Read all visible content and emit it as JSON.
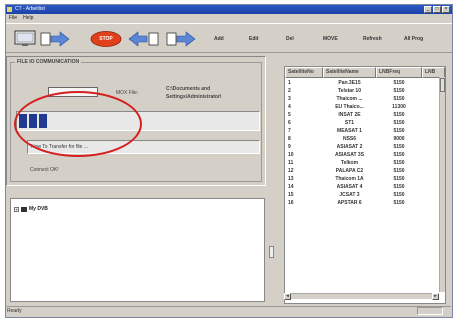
{
  "window": {
    "title": "CT - Arbeitlist",
    "minimize": "_",
    "restore": "□",
    "close": "×"
  },
  "menu": [
    "File",
    "Help"
  ],
  "toolbar": {
    "stop": "STOP",
    "add": "Add",
    "edit": "Edit",
    "del": "Del",
    "move": "MOVE",
    "refresh": "Refresh",
    "all_prog": "All Prog"
  },
  "transfer": {
    "group_title": "FILE IO COMMUNICATION",
    "mox_label": "MOX File:",
    "path_line1": "C:\\Documents and",
    "path_line2": "Settings\\Administrator\\",
    "progress_fraction": 0.12,
    "status_text": "Now To Transfer for file ...",
    "connect_text": "Connect OK!"
  },
  "tree": {
    "expander": "+",
    "root_label": "My DVB"
  },
  "grid": {
    "columns": [
      "SatelliteNo",
      "SatelliteName",
      "LNBFreq",
      "LNB"
    ],
    "rows": [
      [
        "1",
        "Pan.3E15",
        "5150",
        ""
      ],
      [
        "2",
        "Telstar 10",
        "5150",
        ""
      ],
      [
        "3",
        "Thaicom ...",
        "5150",
        ""
      ],
      [
        "4",
        "EU Thaico...",
        "11300",
        ""
      ],
      [
        "5",
        "INSAT 2E",
        "5150",
        ""
      ],
      [
        "6",
        "ST1",
        "5150",
        ""
      ],
      [
        "7",
        "MEASAT 1",
        "5150",
        ""
      ],
      [
        "8",
        "NSS6",
        "9000",
        ""
      ],
      [
        "9",
        "ASIASAT 2",
        "5150",
        ""
      ],
      [
        "10",
        "ASIASAT 3S",
        "5150",
        ""
      ],
      [
        "11",
        "Telkom",
        "5150",
        ""
      ],
      [
        "12",
        "PALAPA C2",
        "5150",
        ""
      ],
      [
        "13",
        "Thaicom 1A",
        "5150",
        ""
      ],
      [
        "14",
        "ASIASAT 4",
        "5150",
        ""
      ],
      [
        "15",
        "JCSAT 3",
        "5150",
        ""
      ],
      [
        "16",
        "APSTAR 6",
        "5150",
        ""
      ]
    ]
  },
  "statusbar": {
    "text": "Ready"
  }
}
